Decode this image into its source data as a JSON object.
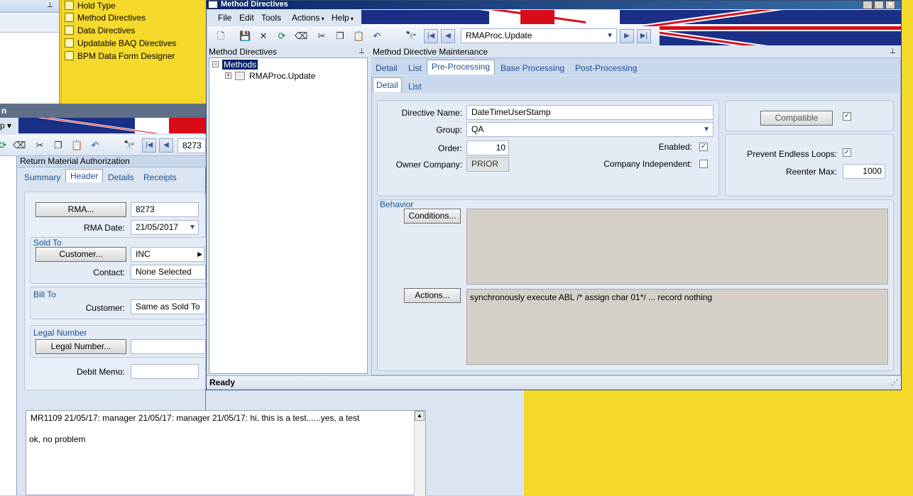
{
  "left_menu": {
    "items": [
      {
        "label": "Hold Type"
      },
      {
        "label": "Method Directives"
      },
      {
        "label": "Data Directives"
      },
      {
        "label": "Updatable BAQ Directives"
      },
      {
        "label": "BPM Data Form Designer"
      }
    ]
  },
  "rma": {
    "title_partial": "n",
    "menu_partial": "p",
    "search_value": "8273",
    "section_title": "Return Material Authorization",
    "tabs": [
      "Summary",
      "Header",
      "Details",
      "Receipts"
    ],
    "active_tab": "Header",
    "rma_button": "RMA...",
    "rma_value": "8273",
    "rma_date_label": "RMA Date:",
    "rma_date_value": "21/05/2017",
    "sold_to_label": "Sold To",
    "customer_button": "Customer...",
    "customer_value": "INC",
    "contact_label": "Contact:",
    "contact_value": "None Selected",
    "bill_to_label": "Bill To",
    "bill_customer_label": "Customer:",
    "bill_customer_value": "Same as Sold To",
    "legal_number_label": "Legal Number",
    "legal_number_button": "Legal Number...",
    "legal_number_value": "",
    "debit_memo_label": "Debit Memo:",
    "debit_memo_value": ""
  },
  "notes": {
    "line1": "MR1109 21/05/17:  manager 21/05/17:  manager 21/05/17: hi, this is a test......yes, a test",
    "line2": "ok, no problem"
  },
  "md": {
    "window_title": "Method Directives",
    "menu": [
      "File",
      "Edit",
      "Tools",
      "Actions",
      "Help"
    ],
    "search_value": "RMAProc.Update",
    "tree_header": "Method Directives",
    "tree_root": "Methods",
    "tree_child": "RMAProc.Update",
    "right_header": "Method Directive Maintenance",
    "tabs": [
      "Detail",
      "List",
      "Pre-Processing",
      "Base Processing",
      "Post-Processing"
    ],
    "active_tab": "Pre-Processing",
    "subtabs": [
      "Detail",
      "List"
    ],
    "active_subtab": "Detail",
    "directive_name_label": "Directive Name:",
    "directive_name_value": "DateTimeUserStamp",
    "group_label": "Group:",
    "group_value": "QA",
    "order_label": "Order:",
    "order_value": "10",
    "enabled_label": "Enabled:",
    "owner_company_label": "Owner Company:",
    "owner_company_value": "PRIOR",
    "company_independent_label": "Company Independent:",
    "compatible_button": "Compatible",
    "prevent_loops_label": "Prevent Endless Loops:",
    "reenter_max_label": "Reenter Max:",
    "reenter_max_value": "1000",
    "behavior_label": "Behavior",
    "conditions_button": "Conditions...",
    "conditions_text": "",
    "actions_button": "Actions...",
    "actions_text": "synchronously execute ABL /* assign char 01*/ ... record nothing",
    "status": "Ready"
  },
  "colors": {
    "desktop": "#f5d92b",
    "panel": "#dbe5f1",
    "accent": "#1d4f91",
    "flag_blue": "#1a2f86",
    "flag_red": "#d80c18"
  }
}
